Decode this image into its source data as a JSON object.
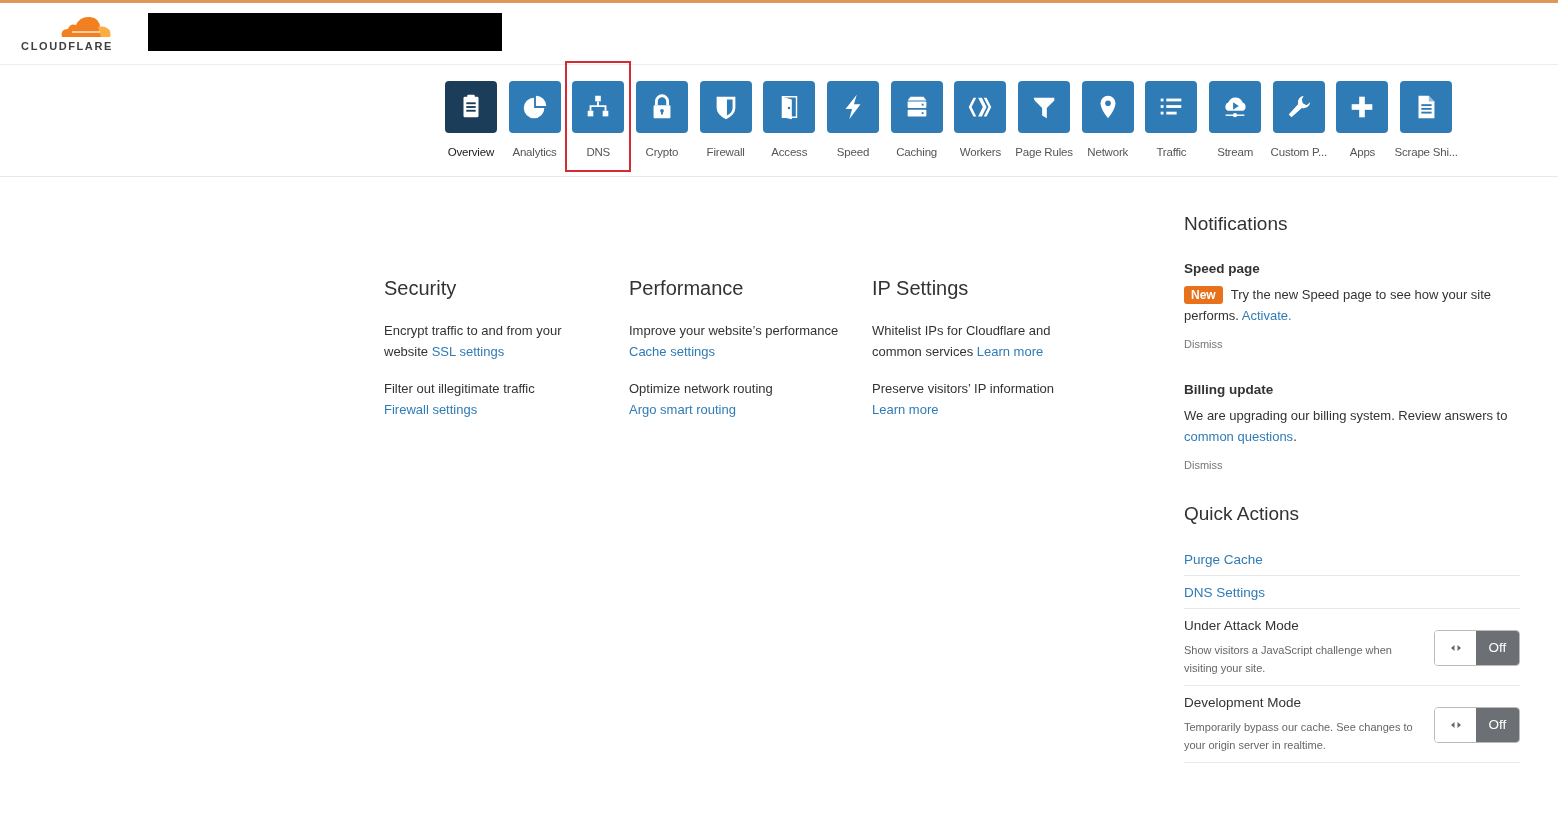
{
  "logo": {
    "text": "CLOUDFLARE"
  },
  "navigation": [
    {
      "label": "Overview",
      "selected": true,
      "highlighted": false
    },
    {
      "label": "Analytics",
      "selected": false,
      "highlighted": false
    },
    {
      "label": "DNS",
      "selected": false,
      "highlighted": true
    },
    {
      "label": "Crypto",
      "selected": false,
      "highlighted": false
    },
    {
      "label": "Firewall",
      "selected": false,
      "highlighted": false
    },
    {
      "label": "Access",
      "selected": false,
      "highlighted": false
    },
    {
      "label": "Speed",
      "selected": false,
      "highlighted": false
    },
    {
      "label": "Caching",
      "selected": false,
      "highlighted": false
    },
    {
      "label": "Workers",
      "selected": false,
      "highlighted": false
    },
    {
      "label": "Page Rules",
      "selected": false,
      "highlighted": false
    },
    {
      "label": "Network",
      "selected": false,
      "highlighted": false
    },
    {
      "label": "Traffic",
      "selected": false,
      "highlighted": false
    },
    {
      "label": "Stream",
      "selected": false,
      "highlighted": false
    },
    {
      "label": "Custom P...",
      "selected": false,
      "highlighted": false
    },
    {
      "label": "Apps",
      "selected": false,
      "highlighted": false
    },
    {
      "label": "Scrape Shi...",
      "selected": false,
      "highlighted": false
    }
  ],
  "sections": [
    {
      "title": "Security",
      "items": [
        {
          "text": "Encrypt traffic to and from your website",
          "link": "SSL settings"
        },
        {
          "text": "Filter out illegitimate traffic",
          "link": "Firewall settings"
        }
      ]
    },
    {
      "title": "Performance",
      "items": [
        {
          "text": "Improve your website’s performance",
          "link": "Cache settings"
        },
        {
          "text": "Optimize network routing",
          "link": "Argo smart routing"
        }
      ]
    },
    {
      "title": "IP Settings",
      "items": [
        {
          "text": "Whitelist IPs for Cloudflare and common services",
          "link": "Learn more"
        },
        {
          "text": "Preserve visitors’ IP information",
          "link": "Learn more"
        }
      ]
    }
  ],
  "notifications": {
    "title": "Notifications",
    "items": [
      {
        "title": "Speed page",
        "badge": "New",
        "text": "Try the new Speed page to see how your site performs.",
        "link": "Activate.",
        "dismiss": "Dismiss"
      },
      {
        "title": "Billing update",
        "text": "We are upgrading our billing system. Review answers to",
        "link": "common questions",
        "after": ".",
        "dismiss": "Dismiss"
      }
    ]
  },
  "quick_actions": {
    "title": "Quick Actions",
    "items": [
      {
        "kind": "link",
        "label": "Purge Cache"
      },
      {
        "kind": "link",
        "label": "DNS Settings"
      },
      {
        "kind": "toggle",
        "label": "Under Attack Mode",
        "description": "Show visitors a JavaScript challenge when visiting your site.",
        "on": false,
        "state_label": "Off"
      },
      {
        "kind": "toggle",
        "label": "Development Mode",
        "description": "Temporarily bypass our cache. See changes to your origin server in realtime.",
        "on": false,
        "state_label": "Off"
      }
    ]
  }
}
